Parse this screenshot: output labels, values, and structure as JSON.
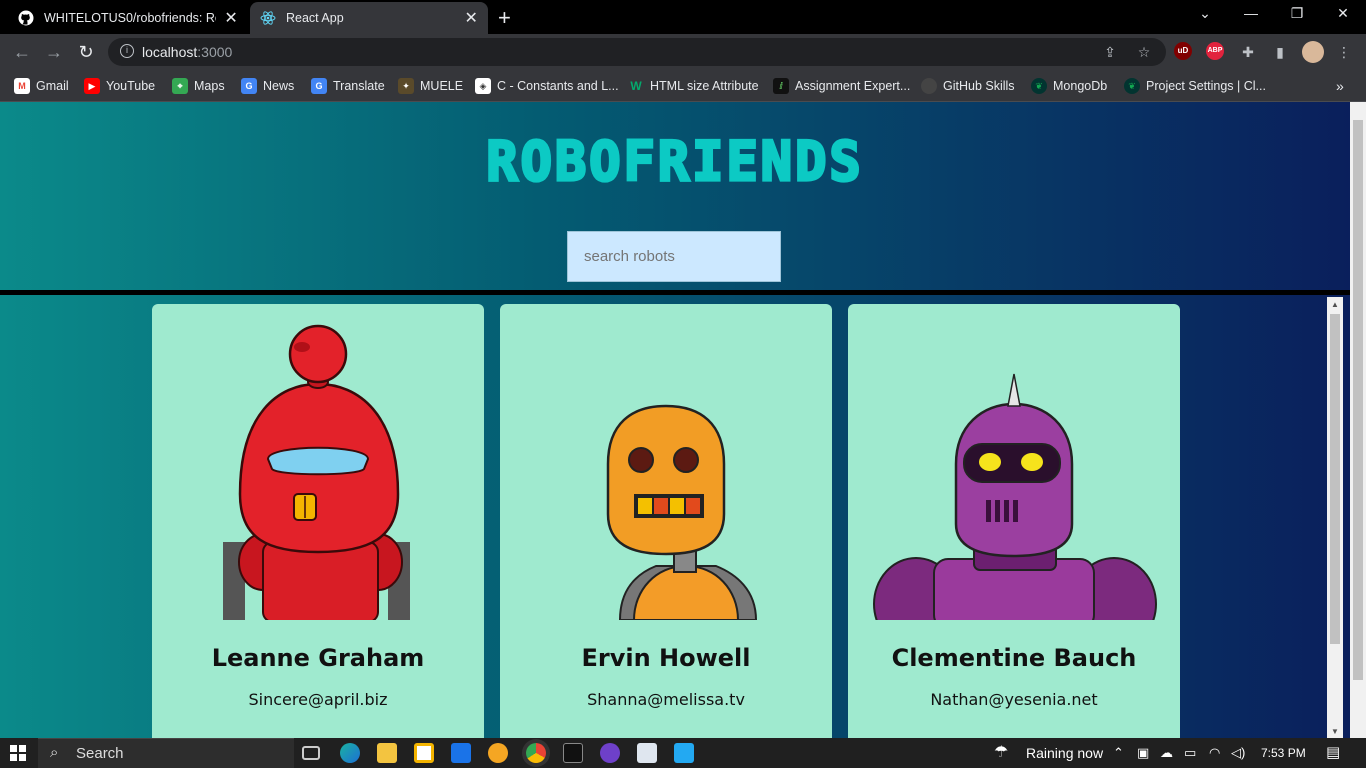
{
  "browser": {
    "tabs": [
      {
        "title": "WHITELOTUS0/robofriends: React"
      },
      {
        "title": "React App"
      }
    ],
    "url_host": "localhost",
    "url_port": ":3000",
    "bookmarks": [
      {
        "label": "Gmail"
      },
      {
        "label": "YouTube"
      },
      {
        "label": "Maps"
      },
      {
        "label": "News"
      },
      {
        "label": "Translate"
      },
      {
        "label": "MUELE"
      },
      {
        "label": "C - Constants and L..."
      },
      {
        "label": "HTML size Attribute"
      },
      {
        "label": "Assignment Expert..."
      },
      {
        "label": "GitHub Skills"
      },
      {
        "label": "MongoDb"
      },
      {
        "label": "Project Settings | Cl..."
      }
    ]
  },
  "app": {
    "title": "ROBOFRIENDS",
    "search_placeholder": "search robots",
    "robots": [
      {
        "name": "Leanne Graham",
        "email": "Sincere@april.biz"
      },
      {
        "name": "Ervin Howell",
        "email": "Shanna@melissa.tv"
      },
      {
        "name": "Clementine Bauch",
        "email": "Nathan@yesenia.net"
      }
    ]
  },
  "taskbar": {
    "search_label": "Search",
    "weather": "Raining now",
    "time": "7:53 PM"
  },
  "colors": {
    "card_bg": "#9feacf",
    "title_color": "#0ccac4",
    "search_bg": "#cce8ff"
  }
}
